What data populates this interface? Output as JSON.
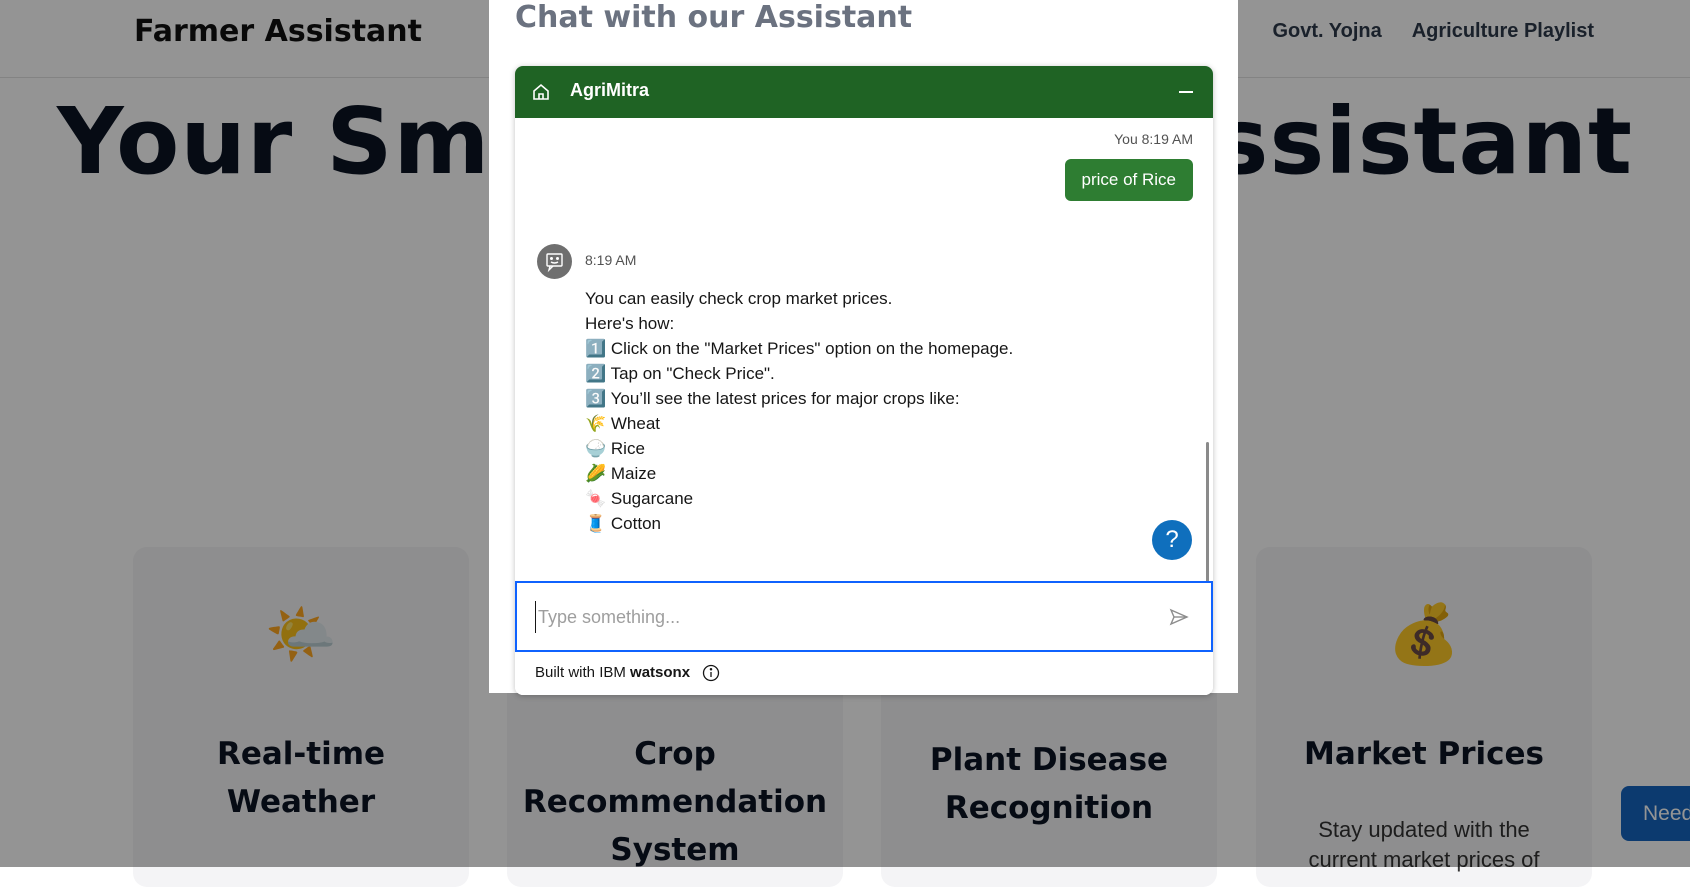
{
  "page": {
    "brand": "Farmer Assistant",
    "nav": [
      "Govt. Yojna",
      "Agriculture Playlist"
    ],
    "hero": "Your Smart Farming Assistant",
    "cards": [
      {
        "icon": "🌤️",
        "title_lines": [
          "Real-time",
          "Weather"
        ],
        "desc_lines": []
      },
      {
        "icon": "",
        "title_lines": [
          "Crop",
          "Recommendation",
          "System"
        ],
        "desc_lines": []
      },
      {
        "icon": "",
        "title_lines": [
          "Plant Disease",
          "Recognition"
        ],
        "desc_lines": []
      },
      {
        "icon": "💰",
        "title_lines": [
          "Market Prices"
        ],
        "desc_lines": [
          "Stay updated with the",
          "current market prices of"
        ]
      }
    ],
    "need_button": "Need"
  },
  "modal": {
    "title": "Chat with our Assistant"
  },
  "chat": {
    "name": "AgriMitra",
    "user_meta": "You 8:19 AM",
    "user_message": "price of Rice",
    "bot_time": "8:19 AM",
    "bot_lines": [
      "You can easily check crop market prices.",
      "Here's how:",
      "1️⃣ Click on the \"Market Prices\" option on the homepage.",
      "2️⃣ Tap on \"Check Price\".",
      "3️⃣ You’ll see the latest prices for major crops like:",
      "🌾 Wheat",
      "🍚 Rice",
      "🌽 Maize",
      "🍬 Sugarcane",
      "🧵 Cotton"
    ],
    "input_placeholder": "Type something...",
    "help_label": "?",
    "footer_prefix": "Built with IBM ",
    "footer_brand": "watsonx"
  },
  "colors": {
    "header_green": "#1f6324",
    "user_bubble": "#2e7d32",
    "input_focus": "#0f62fe",
    "help_blue": "#0f6fbd"
  }
}
